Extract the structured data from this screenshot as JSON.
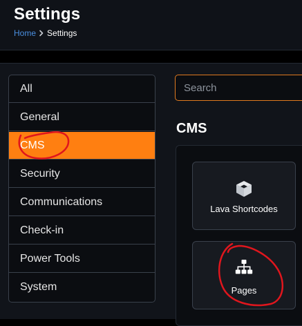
{
  "header": {
    "title": "Settings",
    "breadcrumb": {
      "home": "Home",
      "current": "Settings"
    }
  },
  "nav": {
    "items": [
      {
        "label": "All",
        "active": false
      },
      {
        "label": "General",
        "active": false
      },
      {
        "label": "CMS",
        "active": true
      },
      {
        "label": "Security",
        "active": false
      },
      {
        "label": "Communications",
        "active": false
      },
      {
        "label": "Check-in",
        "active": false
      },
      {
        "label": "Power Tools",
        "active": false
      },
      {
        "label": "System",
        "active": false
      }
    ]
  },
  "search": {
    "placeholder": "Search",
    "value": ""
  },
  "section": {
    "title": "CMS",
    "tiles": [
      {
        "label": "Lava Shortcodes",
        "icon": "cube-icon"
      },
      {
        "label": "Pages",
        "icon": "sitemap-icon"
      }
    ]
  },
  "colors": {
    "accent": "#ff7f11",
    "link": "#4a8fe0",
    "annotation": "#e0161d"
  }
}
